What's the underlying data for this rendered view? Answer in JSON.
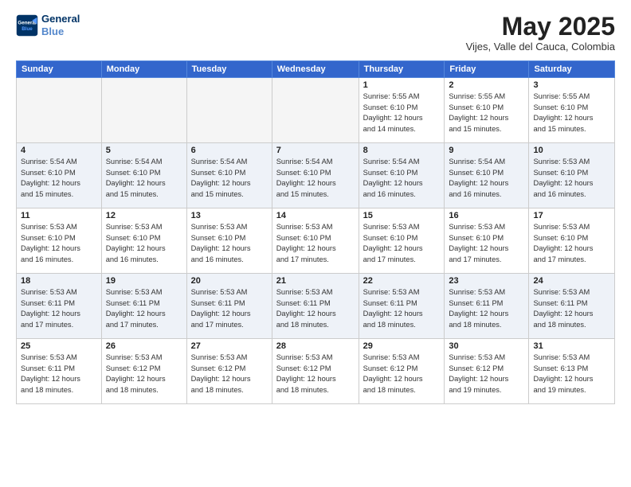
{
  "header": {
    "logo_line1": "General",
    "logo_line2": "Blue",
    "month": "May 2025",
    "location": "Vijes, Valle del Cauca, Colombia"
  },
  "days_of_week": [
    "Sunday",
    "Monday",
    "Tuesday",
    "Wednesday",
    "Thursday",
    "Friday",
    "Saturday"
  ],
  "weeks": [
    [
      {
        "day": "",
        "info": ""
      },
      {
        "day": "",
        "info": ""
      },
      {
        "day": "",
        "info": ""
      },
      {
        "day": "",
        "info": ""
      },
      {
        "day": "1",
        "info": "Sunrise: 5:55 AM\nSunset: 6:10 PM\nDaylight: 12 hours\nand 14 minutes."
      },
      {
        "day": "2",
        "info": "Sunrise: 5:55 AM\nSunset: 6:10 PM\nDaylight: 12 hours\nand 15 minutes."
      },
      {
        "day": "3",
        "info": "Sunrise: 5:55 AM\nSunset: 6:10 PM\nDaylight: 12 hours\nand 15 minutes."
      }
    ],
    [
      {
        "day": "4",
        "info": "Sunrise: 5:54 AM\nSunset: 6:10 PM\nDaylight: 12 hours\nand 15 minutes."
      },
      {
        "day": "5",
        "info": "Sunrise: 5:54 AM\nSunset: 6:10 PM\nDaylight: 12 hours\nand 15 minutes."
      },
      {
        "day": "6",
        "info": "Sunrise: 5:54 AM\nSunset: 6:10 PM\nDaylight: 12 hours\nand 15 minutes."
      },
      {
        "day": "7",
        "info": "Sunrise: 5:54 AM\nSunset: 6:10 PM\nDaylight: 12 hours\nand 15 minutes."
      },
      {
        "day": "8",
        "info": "Sunrise: 5:54 AM\nSunset: 6:10 PM\nDaylight: 12 hours\nand 16 minutes."
      },
      {
        "day": "9",
        "info": "Sunrise: 5:54 AM\nSunset: 6:10 PM\nDaylight: 12 hours\nand 16 minutes."
      },
      {
        "day": "10",
        "info": "Sunrise: 5:53 AM\nSunset: 6:10 PM\nDaylight: 12 hours\nand 16 minutes."
      }
    ],
    [
      {
        "day": "11",
        "info": "Sunrise: 5:53 AM\nSunset: 6:10 PM\nDaylight: 12 hours\nand 16 minutes."
      },
      {
        "day": "12",
        "info": "Sunrise: 5:53 AM\nSunset: 6:10 PM\nDaylight: 12 hours\nand 16 minutes."
      },
      {
        "day": "13",
        "info": "Sunrise: 5:53 AM\nSunset: 6:10 PM\nDaylight: 12 hours\nand 16 minutes."
      },
      {
        "day": "14",
        "info": "Sunrise: 5:53 AM\nSunset: 6:10 PM\nDaylight: 12 hours\nand 17 minutes."
      },
      {
        "day": "15",
        "info": "Sunrise: 5:53 AM\nSunset: 6:10 PM\nDaylight: 12 hours\nand 17 minutes."
      },
      {
        "day": "16",
        "info": "Sunrise: 5:53 AM\nSunset: 6:10 PM\nDaylight: 12 hours\nand 17 minutes."
      },
      {
        "day": "17",
        "info": "Sunrise: 5:53 AM\nSunset: 6:10 PM\nDaylight: 12 hours\nand 17 minutes."
      }
    ],
    [
      {
        "day": "18",
        "info": "Sunrise: 5:53 AM\nSunset: 6:11 PM\nDaylight: 12 hours\nand 17 minutes."
      },
      {
        "day": "19",
        "info": "Sunrise: 5:53 AM\nSunset: 6:11 PM\nDaylight: 12 hours\nand 17 minutes."
      },
      {
        "day": "20",
        "info": "Sunrise: 5:53 AM\nSunset: 6:11 PM\nDaylight: 12 hours\nand 17 minutes."
      },
      {
        "day": "21",
        "info": "Sunrise: 5:53 AM\nSunset: 6:11 PM\nDaylight: 12 hours\nand 18 minutes."
      },
      {
        "day": "22",
        "info": "Sunrise: 5:53 AM\nSunset: 6:11 PM\nDaylight: 12 hours\nand 18 minutes."
      },
      {
        "day": "23",
        "info": "Sunrise: 5:53 AM\nSunset: 6:11 PM\nDaylight: 12 hours\nand 18 minutes."
      },
      {
        "day": "24",
        "info": "Sunrise: 5:53 AM\nSunset: 6:11 PM\nDaylight: 12 hours\nand 18 minutes."
      }
    ],
    [
      {
        "day": "25",
        "info": "Sunrise: 5:53 AM\nSunset: 6:11 PM\nDaylight: 12 hours\nand 18 minutes."
      },
      {
        "day": "26",
        "info": "Sunrise: 5:53 AM\nSunset: 6:12 PM\nDaylight: 12 hours\nand 18 minutes."
      },
      {
        "day": "27",
        "info": "Sunrise: 5:53 AM\nSunset: 6:12 PM\nDaylight: 12 hours\nand 18 minutes."
      },
      {
        "day": "28",
        "info": "Sunrise: 5:53 AM\nSunset: 6:12 PM\nDaylight: 12 hours\nand 18 minutes."
      },
      {
        "day": "29",
        "info": "Sunrise: 5:53 AM\nSunset: 6:12 PM\nDaylight: 12 hours\nand 18 minutes."
      },
      {
        "day": "30",
        "info": "Sunrise: 5:53 AM\nSunset: 6:12 PM\nDaylight: 12 hours\nand 19 minutes."
      },
      {
        "day": "31",
        "info": "Sunrise: 5:53 AM\nSunset: 6:13 PM\nDaylight: 12 hours\nand 19 minutes."
      }
    ]
  ]
}
